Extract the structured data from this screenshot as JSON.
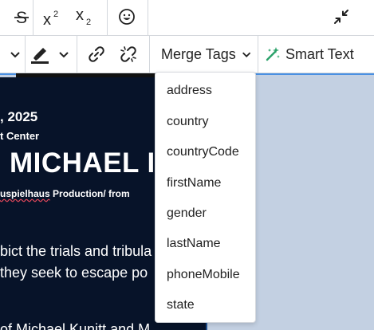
{
  "toolbar": {
    "merge_tags_label": "Merge Tags",
    "smart_text_label": "Smart Text",
    "accent_color": "#2ba26a",
    "icons": [
      "strikethrough-icon",
      "superscript-icon",
      "subscript-icon",
      "emoji-icon",
      "collapse-icon",
      "chevron-down-icon",
      "highlighter-icon",
      "link-icon",
      "unlink-icon",
      "magic-wand-icon"
    ]
  },
  "merge_tags": {
    "items": [
      "address",
      "country",
      "countryCode",
      "firstName",
      "gender",
      "lastName",
      "phoneMobile",
      "state"
    ]
  },
  "document": {
    "date": ", 2025",
    "venue": "t Center",
    "name": " MICHAEL I",
    "production_squiggle": "uspielhaus",
    "production_rest": " Production/ from",
    "body_line1": "bict the trials and tribula",
    "body_line2": "they seek to escape po",
    "body_line3": "of Michael Kunitt and M"
  }
}
